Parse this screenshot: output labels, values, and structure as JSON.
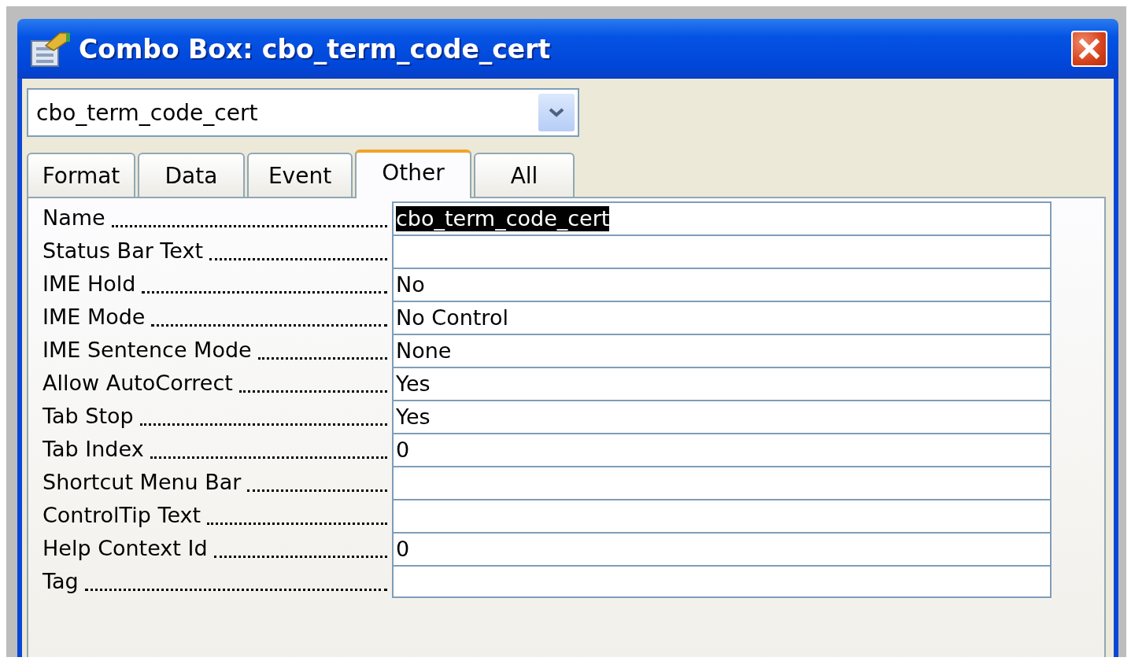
{
  "window": {
    "title": "Combo Box: cbo_term_code_cert"
  },
  "object_selector": {
    "value": "cbo_term_code_cert"
  },
  "tabs": [
    {
      "label": "Format",
      "selected": false
    },
    {
      "label": "Data",
      "selected": false
    },
    {
      "label": "Event",
      "selected": false
    },
    {
      "label": "Other",
      "selected": true
    },
    {
      "label": "All",
      "selected": false
    }
  ],
  "properties": [
    {
      "name": "Name",
      "value": "cbo_term_code_cert",
      "highlighted": true
    },
    {
      "name": "Status Bar Text"
    },
    {
      "name": "IME Hold",
      "value": "No",
      "highlighted": false
    },
    {
      "name": "IME Mode",
      "value": "No Control",
      "highlighted": false
    },
    {
      "name": "IME Sentence Mode",
      "value": "None",
      "highlighted": false
    },
    {
      "name": "Allow AutoCorrect",
      "value": "Yes",
      "highlighted": false
    },
    {
      "name": "Tab Stop",
      "value": "Yes",
      "highlighted": false
    },
    {
      "name": "Tab Index",
      "value": "0",
      "highlighted": false
    },
    {
      "name": "Shortcut Menu Bar"
    },
    {
      "name": "ControlTip Text"
    },
    {
      "name": "Help Context Id",
      "value": "0",
      "highlighted": false
    },
    {
      "name": "Tag"
    }
  ]
}
